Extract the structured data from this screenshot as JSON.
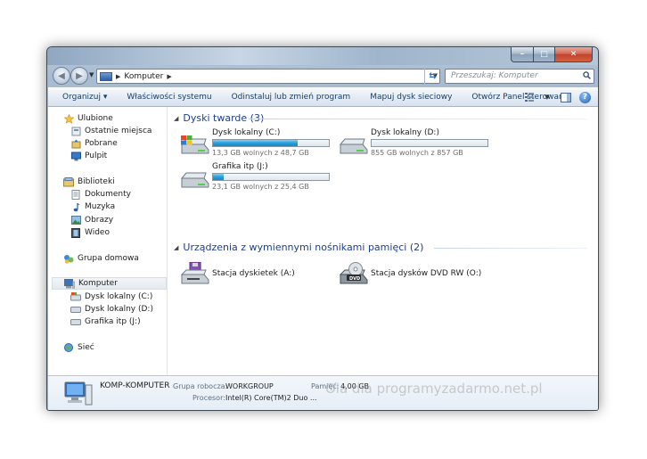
{
  "window": {
    "caption": {
      "minimize": "–",
      "maximize": "□",
      "close": "✕"
    }
  },
  "address": {
    "path": [
      "Komputer"
    ],
    "search_placeholder": "Przeszukaj: Komputer"
  },
  "toolbar": {
    "organize": "Organizuj ▾",
    "system_properties": "Właściwości systemu",
    "uninstall": "Odinstaluj lub zmień program",
    "map_drive": "Mapuj dysk sieciowy",
    "control_panel": "Otwórz Panel sterowania"
  },
  "sidebar": {
    "favorites": "Ulubione",
    "recent": "Ostatnie miejsca",
    "downloads": "Pobrane",
    "desktop": "Pulpit",
    "libraries": "Biblioteki",
    "documents": "Dokumenty",
    "music": "Muzyka",
    "pictures": "Obrazy",
    "videos": "Wideo",
    "homegroup": "Grupa domowa",
    "computer": "Komputer",
    "drive_c": "Dysk lokalny (C:)",
    "drive_d": "Dysk lokalny (D:)",
    "drive_j": "Grafika itp (J:)",
    "network": "Sieć"
  },
  "groups": {
    "hard_disks": "Dyski twarde (3)",
    "removable": "Urządzenia z wymiennymi nośnikami pamięci (2)"
  },
  "drives": [
    {
      "name": "Dysk lokalny (C:)",
      "free_text": "13,3 GB wolnych z 48,7 GB",
      "used_fraction": 0.727
    },
    {
      "name": "Dysk lokalny (D:)",
      "free_text": "855 GB wolnych z 857 GB",
      "used_fraction": 0.002
    },
    {
      "name": "Grafika itp (J:)",
      "free_text": "23,1 GB wolnych z 25,4 GB",
      "used_fraction": 0.09
    }
  ],
  "devices": [
    {
      "name": "Stacja dyskietek (A:)"
    },
    {
      "name": "Stacja dysków DVD RW (O:)",
      "badge": "DVD"
    }
  ],
  "details": {
    "computer_name": "KOMP-KOMPUTER",
    "workgroup_label": "Grupa robocza:",
    "workgroup_value": "WORKGROUP",
    "memory_label": "Pamięć:",
    "memory_value": "4,00 GB",
    "processor_label": "Procesor:",
    "processor_value": "Intel(R) Core(TM)2 Duo ..."
  },
  "watermark": "Ola dla programyzadarmo.net.pl"
}
